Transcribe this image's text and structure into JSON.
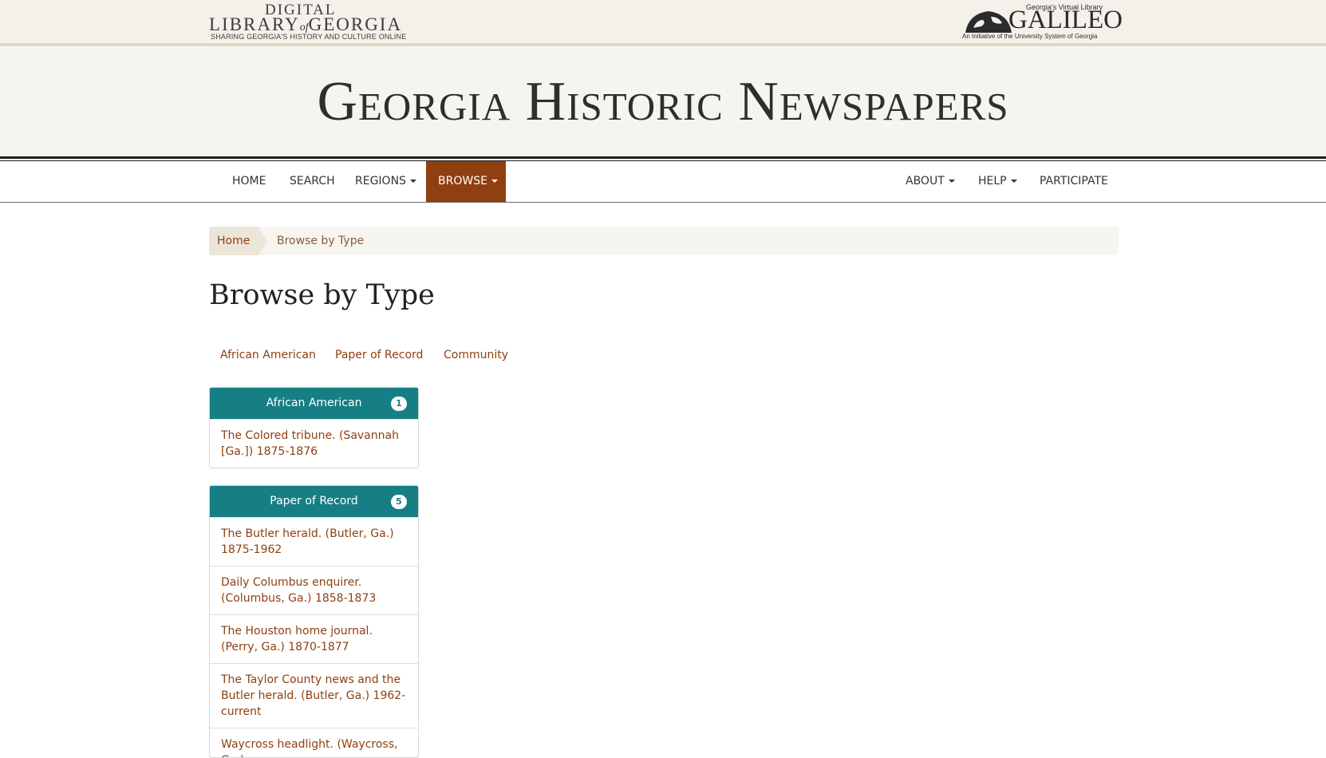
{
  "header": {
    "dlg_logo": {
      "line1": "DIGITAL",
      "line2_a": "LIBRARY",
      "line2_of": "of",
      "line2_b": "GEORGIA",
      "tagline": "SHARING GEORGIA'S HISTORY AND CULTURE ONLINE"
    },
    "galileo_logo": {
      "top": "Georgia's Virtual Library",
      "name": "GALILEO",
      "sub": "An Initiative of the University System of Georgia"
    },
    "site_title": "Georgia Historic Newspapers"
  },
  "nav": {
    "left": [
      {
        "label": "HOME"
      },
      {
        "label": "SEARCH"
      },
      {
        "label": "REGIONS"
      },
      {
        "label": "BROWSE"
      }
    ],
    "right": [
      {
        "label": "ABOUT"
      },
      {
        "label": "HELP"
      },
      {
        "label": "PARTICIPATE"
      }
    ]
  },
  "breadcrumb": {
    "home": "Home",
    "current": "Browse by Type"
  },
  "page_title": "Browse by Type",
  "tabs": [
    "African American",
    "Paper of Record",
    "Community"
  ],
  "panels": [
    {
      "title": "African American",
      "count": "1",
      "items": [
        "The Colored tribune. (Savannah [Ga.]) 1875-1876"
      ]
    },
    {
      "title": "Paper of Record",
      "count": "5",
      "items": [
        "The Butler herald. (Butler, Ga.) 1875-1962",
        "Daily Columbus enquirer. (Columbus, Ga.) 1858-1873",
        "The Houston home journal. (Perry, Ga.) 1870-1877",
        "The Taylor County news and the Butler herald. (Butler, Ga.) 1962-current",
        "Waycross headlight. (Waycross, Ga.)"
      ]
    }
  ],
  "colors": {
    "accent": "#8f3f10",
    "panel_header": "#167f86",
    "banner_bg": "#f5f4ef"
  }
}
